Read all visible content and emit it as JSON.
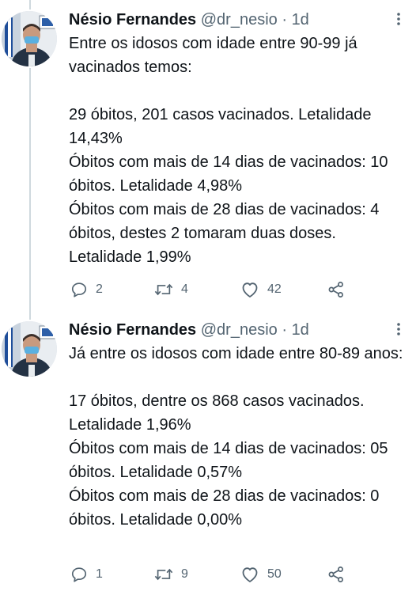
{
  "tweets": [
    {
      "name": "Nésio Fernandes",
      "handle": "@dr_nesio",
      "dot": "·",
      "time": "1d",
      "text": "Entre os idosos com idade entre 90-99 já vacinados temos:\n\n29 óbitos, 201 casos vacinados. Letalidade 14,43%\nÓbitos com mais de 14 dias de vacinados: 10 óbitos. Letalidade 4,98%\nÓbitos com mais de 28 dias de vacinados: 4 óbitos, destes 2 tomaram duas doses. Letalidade 1,99%",
      "replies": "2",
      "retweets": "4",
      "likes": "42",
      "icons": {
        "reply": "reply-icon",
        "retweet": "retweet-icon",
        "like": "heart-icon",
        "share": "share-icon",
        "more": "more-vertical-icon"
      }
    },
    {
      "name": "Nésio Fernandes",
      "handle": "@dr_nesio",
      "dot": "·",
      "time": "1d",
      "text": "Já entre os idosos com idade entre 80-89 anos:\n\n17 óbitos, dentre os 868 casos vacinados. Letalidade 1,96%\nÓbitos com mais de 14 dias de vacinados: 05 óbitos. Letalidade 0,57%\nÓbitos com mais de 28 dias de vacinados: 0 óbitos. Letalidade 0,00%",
      "replies": "1",
      "retweets": "9",
      "likes": "50",
      "icons": {
        "reply": "reply-icon",
        "retweet": "retweet-icon",
        "like": "heart-icon",
        "share": "share-icon",
        "more": "more-vertical-icon"
      }
    }
  ],
  "colors": {
    "text": "#0f1419",
    "secondary": "#536471",
    "thread_line": "#cfd9de"
  }
}
